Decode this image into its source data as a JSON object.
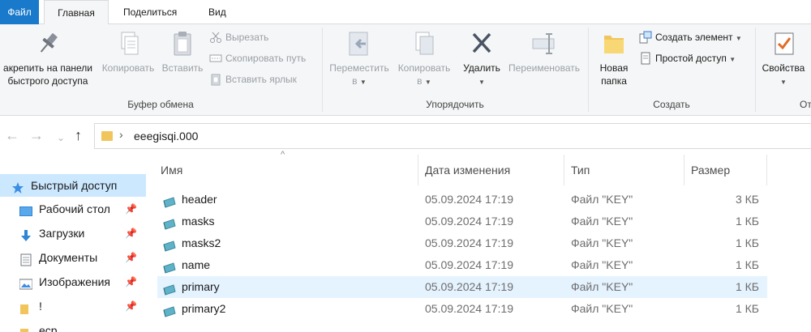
{
  "tabs": {
    "file": "Файл",
    "home": "Главная",
    "share": "Поделиться",
    "view": "Вид"
  },
  "ribbon": {
    "clipboard": {
      "pin_line1": "акрепить на панели",
      "pin_line2": "быстрого доступа",
      "copy": "Копировать",
      "paste": "Вставить",
      "cut": "Вырезать",
      "copy_path": "Скопировать путь",
      "paste_shortcut": "Вставить ярлык",
      "label": "Буфер обмена"
    },
    "organize": {
      "move_line1": "Переместить",
      "move_line2": "в",
      "copy_line1": "Копировать",
      "copy_line2": "в",
      "delete": "Удалить",
      "rename": "Переименовать",
      "label": "Упорядочить"
    },
    "new": {
      "folder_line1": "Новая",
      "folder_line2": "папка",
      "new_item": "Создать элемент",
      "easy_access": "Простой доступ",
      "label": "Создать"
    },
    "open": {
      "properties": "Свойства",
      "label": "От"
    }
  },
  "address": {
    "path": "eeegisqi.000"
  },
  "navpane": {
    "quick_access": "Быстрый доступ",
    "items": [
      {
        "label": "Рабочий стол",
        "icon": "desktop-icon"
      },
      {
        "label": "Загрузки",
        "icon": "downloads-icon"
      },
      {
        "label": "Документы",
        "icon": "documents-icon"
      },
      {
        "label": "Изображения",
        "icon": "pictures-icon"
      },
      {
        "label": "!",
        "icon": "folder-icon"
      },
      {
        "label": "ecp",
        "icon": "folder-icon"
      }
    ]
  },
  "columns": {
    "name": "Имя",
    "date": "Дата изменения",
    "type": "Тип",
    "size": "Размер"
  },
  "files": [
    {
      "name": "header",
      "date": "05.09.2024 17:19",
      "type": "Файл \"KEY\"",
      "size": "3 КБ"
    },
    {
      "name": "masks",
      "date": "05.09.2024 17:19",
      "type": "Файл \"KEY\"",
      "size": "1 КБ"
    },
    {
      "name": "masks2",
      "date": "05.09.2024 17:19",
      "type": "Файл \"KEY\"",
      "size": "1 КБ"
    },
    {
      "name": "name",
      "date": "05.09.2024 17:19",
      "type": "Файл \"KEY\"",
      "size": "1 КБ"
    },
    {
      "name": "primary",
      "date": "05.09.2024 17:19",
      "type": "Файл \"KEY\"",
      "size": "1 КБ"
    },
    {
      "name": "primary2",
      "date": "05.09.2024 17:19",
      "type": "Файл \"KEY\"",
      "size": "1 КБ"
    }
  ]
}
